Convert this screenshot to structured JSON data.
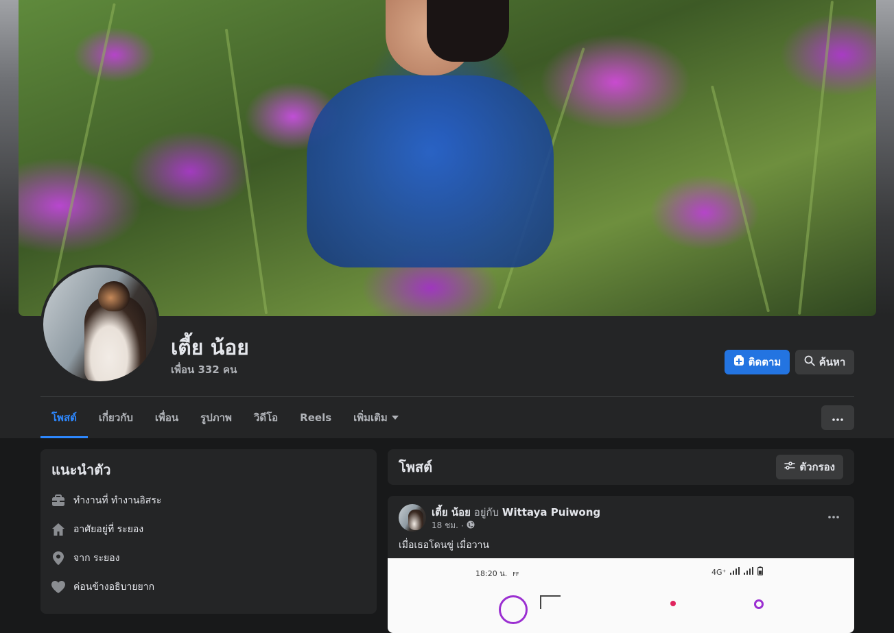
{
  "profile": {
    "name": "เตี้ย น้อย",
    "friends": "เพื่อน 332 คน",
    "follow_label": "ติดตาม",
    "search_label": "ค้นหา"
  },
  "tabs": [
    {
      "label": "โพสต์",
      "active": true
    },
    {
      "label": "เกี่ยวกับ",
      "active": false
    },
    {
      "label": "เพื่อน",
      "active": false
    },
    {
      "label": "รูปภาพ",
      "active": false
    },
    {
      "label": "วิดีโอ",
      "active": false
    },
    {
      "label": "Reels",
      "active": false
    },
    {
      "label": "เพิ่มเติม",
      "active": false
    }
  ],
  "intro": {
    "title": "แนะนำตัว",
    "items": [
      {
        "icon": "briefcase-icon",
        "text": "ทำงานที่ ทำงานอิสระ"
      },
      {
        "icon": "home-icon",
        "text": "อาศัยอยู่ที่ ระยอง"
      },
      {
        "icon": "location-pin-icon",
        "text": "จาก ระยอง"
      },
      {
        "icon": "heart-icon",
        "text": "ค่อนข้างอธิบายยาก"
      }
    ]
  },
  "posts_header": {
    "title": "โพสต์",
    "filter_label": "ตัวกรอง"
  },
  "post": {
    "author": "เตี้ย น้อย",
    "with_text": "อยู่กับ",
    "tagged": "Wittaya Puiwong",
    "time": "18 ชม.",
    "text": "เมื่อเธอโดนขู่ เมื่อวาน",
    "image": {
      "status_time": "18:20 น.",
      "status_ff": "FF",
      "network": "4G⁺"
    }
  },
  "colors": {
    "accent": "#2d88ff",
    "follow_button": "#2374e1",
    "card": "#242526",
    "page_bg": "#18191a"
  }
}
